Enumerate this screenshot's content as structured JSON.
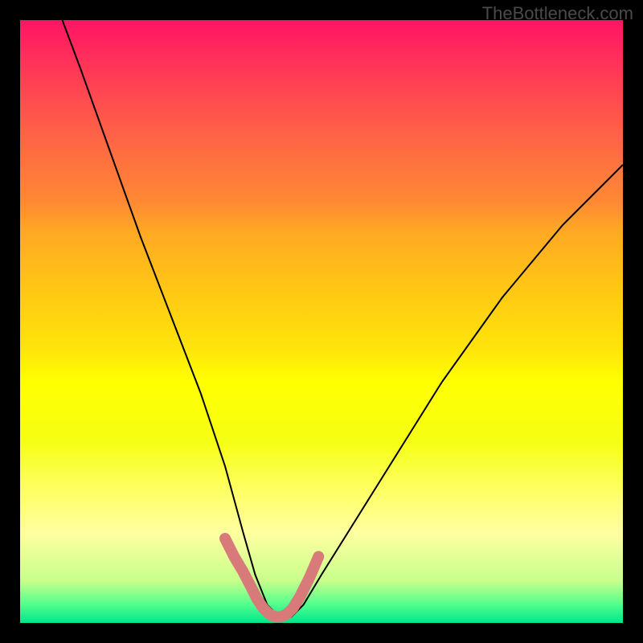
{
  "watermark": "TheBottleneck.com",
  "chart_data": {
    "type": "line",
    "title": "",
    "xlabel": "",
    "ylabel": "",
    "xlim": [
      0,
      100
    ],
    "ylim": [
      0,
      100
    ],
    "axes_visible": false,
    "background": "rainbow-gradient-vertical",
    "series": [
      {
        "name": "bottleneck-curve",
        "description": "V-shaped curve descending from top-left to a minimum near x≈42 then rising to the right edge",
        "x": [
          7,
          10,
          15,
          20,
          25,
          30,
          34,
          37,
          39,
          41,
          43,
          45,
          47,
          50,
          55,
          60,
          65,
          70,
          75,
          80,
          85,
          90,
          95,
          100
        ],
        "y_pct": [
          100,
          92,
          78,
          64,
          51,
          38,
          26,
          15,
          8,
          3,
          1,
          1,
          3,
          8,
          16,
          24,
          32,
          40,
          47,
          54,
          60,
          66,
          71,
          76
        ],
        "color": "#000000",
        "width": 2
      },
      {
        "name": "highlight-segment",
        "description": "Thick salmon overlay around the minimum region",
        "x": [
          34,
          35.5,
          37,
          38.3,
          39.3,
          40.3,
          41.3,
          42.3,
          43.3,
          44.3,
          45.3,
          46.5,
          48,
          49.5
        ],
        "y_pct": [
          14,
          11,
          8.5,
          6,
          4,
          2.5,
          1.5,
          1.0,
          1.0,
          1.5,
          2.5,
          4.5,
          7.5,
          11
        ],
        "color": "#d97a7a",
        "width": 14,
        "linecap": "round"
      }
    ]
  }
}
